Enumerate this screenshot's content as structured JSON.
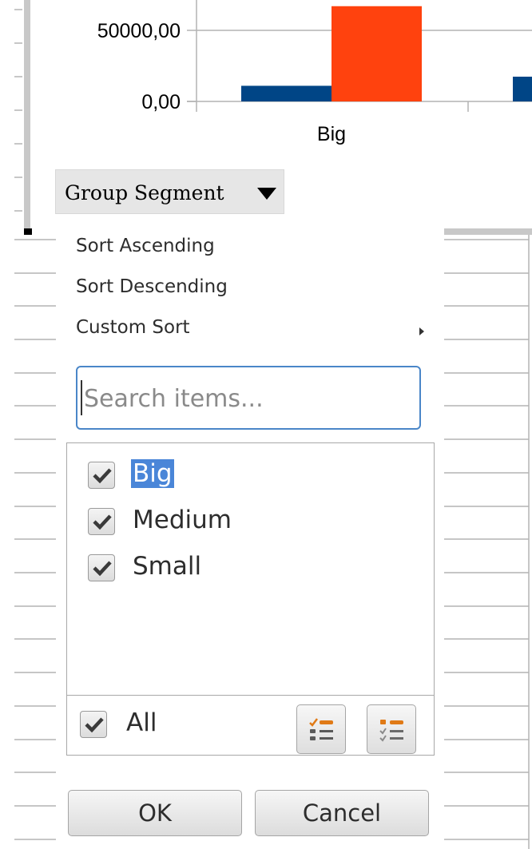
{
  "chart_data": {
    "type": "bar",
    "categories": [
      "Big"
    ],
    "y_ticks": [
      "0,00",
      "50000,00"
    ],
    "series": [
      {
        "color": "#004586",
        "values": [
          11000
        ]
      },
      {
        "color": "#ff420e",
        "values": [
          67000
        ]
      }
    ],
    "ylim": [
      0,
      67000
    ]
  },
  "pivot_field": {
    "label": "Group Segment",
    "arrow_icon": "dropdown-triangle-icon"
  },
  "popup": {
    "menu": {
      "sort_ascending": "Sort Ascending",
      "sort_descending": "Sort Descending",
      "custom_sort": "Custom Sort"
    },
    "search": {
      "value": "",
      "placeholder": "Search items..."
    },
    "items": [
      {
        "label": "Big",
        "checked": true,
        "selected": true
      },
      {
        "label": "Medium",
        "checked": true,
        "selected": false
      },
      {
        "label": "Small",
        "checked": true,
        "selected": false
      }
    ],
    "all_label": "All",
    "buttons": {
      "ok": "OK",
      "cancel": "Cancel"
    }
  },
  "colors": {
    "accent": "#4a86c8",
    "selection": "#4a86d8"
  }
}
